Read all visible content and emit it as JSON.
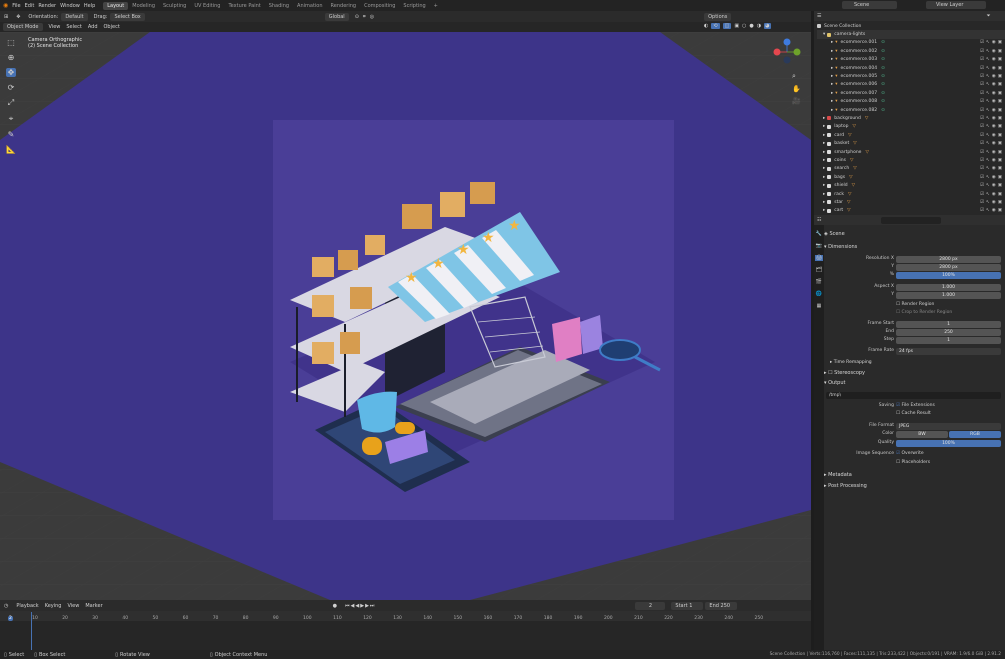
{
  "topbar": {
    "menus": [
      "File",
      "Edit",
      "Render",
      "Window",
      "Help"
    ],
    "workspaces": [
      "Layout",
      "Modeling",
      "Sculpting",
      "UV Editing",
      "Texture Paint",
      "Shading",
      "Animation",
      "Rendering",
      "Compositing",
      "Scripting"
    ],
    "active_workspace": "Layout",
    "scene": "Scene",
    "view_layer": "View Layer"
  },
  "header": {
    "orientation_label": "Orientation:",
    "orientation_value": "Default",
    "drag_label": "Drag:",
    "drag_value": "Select Box",
    "transform": "Global",
    "options": "Options",
    "mode": "Object Mode",
    "menus": [
      "View",
      "Select",
      "Add",
      "Object"
    ]
  },
  "viewport": {
    "camera": "Camera Orthographic",
    "collection": "(2) Scene Collection"
  },
  "outliner": {
    "root": "Scene Collection",
    "collection": "camera-lights",
    "cameras": [
      "ecommerce.001",
      "ecommerce.002",
      "ecommerce.003",
      "ecommerce.004",
      "ecommerce.005",
      "ecommerce.006",
      "ecommerce.007",
      "ecommerce.008",
      "ecommerce.082"
    ],
    "objects": [
      "background",
      "laptop",
      "card",
      "basket",
      "smartphone",
      "coins",
      "search",
      "bags",
      "shield",
      "rack",
      "star",
      "cart"
    ]
  },
  "properties": {
    "scene": "Scene",
    "dimensions": "Dimensions",
    "resolution_x_label": "Resolution X",
    "resolution_x": "2800 px",
    "y_label": "Y",
    "resolution_y": "2800 px",
    "pct_label": "%",
    "pct": "100%",
    "aspect_x_label": "Aspect X",
    "aspect_x": "1.000",
    "aspect_y": "1.000",
    "render_region": "Render Region",
    "crop": "Crop to Render Region",
    "frame_start_label": "Frame Start",
    "frame_start": "1",
    "end_label": "End",
    "frame_end": "250",
    "step_label": "Step",
    "step": "1",
    "frame_rate_label": "Frame Rate",
    "frame_rate": "24 fps",
    "time_remapping": "Time Remapping",
    "stereoscopy": "Stereoscopy",
    "output": "Output",
    "path": "/tmp\\",
    "saving_label": "Saving",
    "file_ext": "File Extensions",
    "cache": "Cache Result",
    "format_label": "File Format",
    "format": "JPEG",
    "color_label": "Color",
    "bw": "BW",
    "rgb": "RGB",
    "quality_label": "Quality",
    "quality": "100%",
    "seq_label": "Image Sequence",
    "overwrite": "Overwrite",
    "placeholders": "Placeholders",
    "metadata": "Metadata",
    "post": "Post Processing"
  },
  "timeline": {
    "menus": [
      "Playback",
      "Keying",
      "View",
      "Marker"
    ],
    "current": "2",
    "start_label": "Start",
    "start": "1",
    "end_label": "End",
    "end": "250",
    "ticks": [
      "2",
      "10",
      "20",
      "30",
      "40",
      "50",
      "60",
      "70",
      "80",
      "90",
      "100",
      "110",
      "120",
      "130",
      "140",
      "150",
      "160",
      "170",
      "180",
      "190",
      "200",
      "210",
      "220",
      "230",
      "240",
      "250"
    ]
  },
  "status": {
    "select": "Select",
    "box_select": "Box Select",
    "rotate": "Rotate View",
    "context": "Object Context Menu",
    "stats": "Scene Collection | Verts:116,760 | Faces:111,135 | Tris:233,422 | Objects:0/191 | VRAM: 1.9/6.0 GiB | 2.91.2"
  }
}
